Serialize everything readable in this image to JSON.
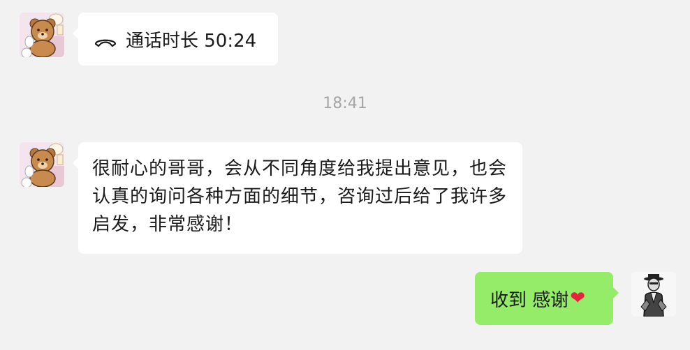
{
  "chat": {
    "messages": [
      {
        "sender": "contact",
        "type": "call",
        "icon": "phone-hangup-icon",
        "text": "通话时长 50:24"
      },
      {
        "type": "time",
        "text": "18:41"
      },
      {
        "sender": "contact",
        "type": "text",
        "text": "很耐心的哥哥，会从不同角度给我提出意见，也会认真的询问各种方面的细节，咨询过后给了我许多启发，非常感谢！"
      },
      {
        "sender": "self",
        "type": "text",
        "text": "收到 感谢",
        "emoji": "❤"
      }
    ]
  },
  "colors": {
    "background": "#f2f2f2",
    "incoming_bubble": "#ffffff",
    "outgoing_bubble": "#95ec69",
    "timestamp": "#a6a6a6"
  }
}
